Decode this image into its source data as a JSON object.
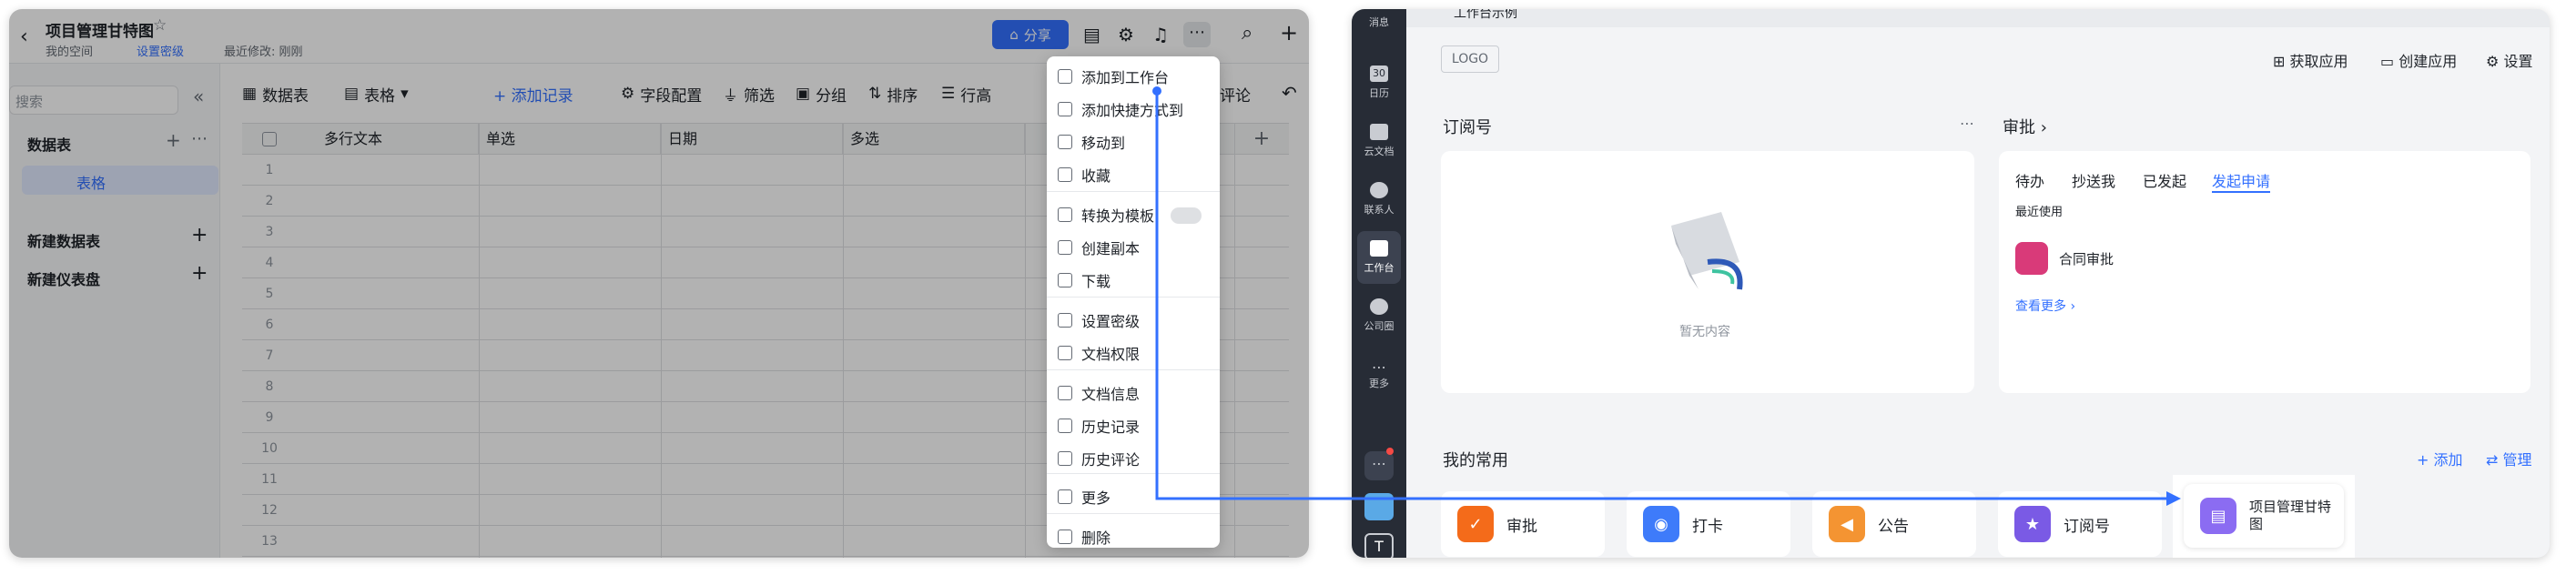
{
  "left": {
    "title": "项目管理甘特图",
    "breadcrumb_space": "我的空间",
    "set_password": "设置密级",
    "last_modified": "最近修改: 刚刚",
    "share_label": "分享",
    "search_placeholder": "搜索",
    "sidebar": {
      "table_group": "数据表",
      "table_item": "表格",
      "new_table": "新建数据表",
      "new_dashboard": "新建仪表盘"
    },
    "toolbar": {
      "datatable": "数据表",
      "table": "表格",
      "add_record": "+ 添加记录",
      "field_config": "字段配置",
      "filter": "筛选",
      "group": "分组",
      "sort": "排序",
      "row_height": "行高",
      "comment": "评论"
    },
    "columns": [
      "多行文本",
      "单选",
      "日期",
      "多选"
    ],
    "rows": [
      "1",
      "2",
      "3",
      "4",
      "5",
      "6",
      "7",
      "8",
      "9",
      "10",
      "11",
      "12",
      "13"
    ],
    "menu": [
      {
        "label": "添加到工作台",
        "icon": "workbench-icon"
      },
      {
        "label": "添加快捷方式到",
        "icon": "shortcut-icon"
      },
      {
        "label": "移动到",
        "icon": "move-icon"
      },
      {
        "label": "收藏",
        "icon": "star-icon"
      },
      {
        "label": "转换为模板",
        "icon": "template-icon"
      },
      {
        "label": "创建副本",
        "icon": "copy-icon"
      },
      {
        "label": "下载",
        "icon": "download-icon"
      },
      {
        "label": "设置密级",
        "icon": "security-icon"
      },
      {
        "label": "文档权限",
        "icon": "permission-icon"
      },
      {
        "label": "文档信息",
        "icon": "info-icon"
      },
      {
        "label": "历史记录",
        "icon": "history-icon"
      },
      {
        "label": "历史评论",
        "icon": "comment-history-icon"
      },
      {
        "label": "更多",
        "icon": "more-icon"
      },
      {
        "label": "删除",
        "icon": "delete-icon"
      }
    ]
  },
  "right": {
    "workspace_name": "工作台示例",
    "rail": [
      "消息",
      "日历",
      "云文档",
      "联系人",
      "工作台",
      "公司圈",
      "更多"
    ],
    "calendar_day": "30",
    "logo_label": "LOGO",
    "get_apps": "获取应用",
    "create_app": "创建应用",
    "settings": "设置",
    "subscription_title": "订阅号",
    "empty_text": "暂无内容",
    "approval_title": "审批",
    "approval_tabs": [
      "待办",
      "抄送我",
      "已发起",
      "发起申请"
    ],
    "recent_used": "最近使用",
    "contract_approval": "合同审批",
    "see_more": "查看更多",
    "my_common": "我的常用",
    "add": "+ 添加",
    "manage": "管理",
    "tiles": [
      "审批",
      "打卡",
      "公告",
      "订阅号",
      "项目管理甘特图"
    ]
  },
  "colors": {
    "accent": "#3370ff",
    "rail_bg": "#272c36",
    "approve_orange": "#f46b1a",
    "checkin_blue": "#3e7bfa",
    "notice_orange": "#f49432",
    "subscribe_purple": "#7a5ae5",
    "gantt_purple": "#8b6cf2"
  }
}
